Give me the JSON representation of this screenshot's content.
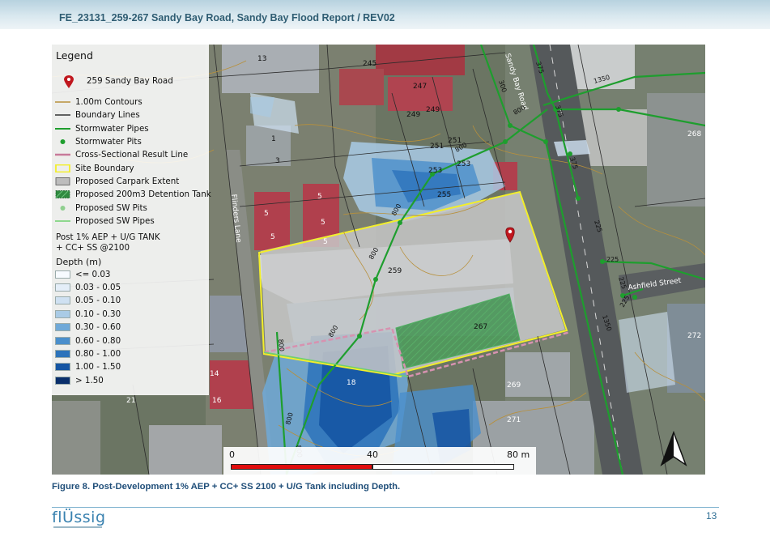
{
  "header": {
    "title": "FE_23131_259-267 Sandy Bay Road, Sandy Bay Flood Report / REV02"
  },
  "legend": {
    "title": "Legend",
    "items": [
      {
        "label": "259 Sandy Bay Road",
        "symbol": "marker",
        "color": "#c0171e"
      },
      {
        "label": "1.00m Contours",
        "symbol": "line",
        "color": "#b8903b"
      },
      {
        "label": "Boundary Lines",
        "symbol": "line",
        "color": "#333333"
      },
      {
        "label": "Stormwater Pipes",
        "symbol": "line",
        "color": "#1e9e2e"
      },
      {
        "label": "Stormwater Pits",
        "symbol": "dot",
        "color": "#1e9e2e"
      },
      {
        "label": "Cross-Sectional Result Line",
        "symbol": "line",
        "color": "#c77a9a"
      },
      {
        "label": "Site Boundary",
        "symbol": "box",
        "color": "#f2ee2a"
      },
      {
        "label": "Proposed Carpark Extent",
        "symbol": "box",
        "color": "#bdbdbd"
      },
      {
        "label": "Proposed 200m3 Detention Tank",
        "symbol": "hatch",
        "color": "#2f8a3f"
      },
      {
        "label": "Proposed SW Pits",
        "symbol": "dot",
        "color": "#8fcf8f"
      },
      {
        "label": "Proposed SW Pipes",
        "symbol": "line",
        "color": "#6fd06f"
      }
    ],
    "scenario_heading_line1": "Post 1% AEP + U/G TANK",
    "scenario_heading_line2": "+ CC+ SS @2100",
    "depth_heading": "Depth (m)",
    "depth_classes": [
      {
        "label": "<= 0.03",
        "color": "#f7fbff"
      },
      {
        "label": "0.03 - 0.05",
        "color": "#e4eef8"
      },
      {
        "label": "0.05 - 0.10",
        "color": "#cfe1f2"
      },
      {
        "label": "0.10 - 0.30",
        "color": "#a9cbe6"
      },
      {
        "label": "0.30 - 0.60",
        "color": "#6fa9d8"
      },
      {
        "label": "0.60 - 0.80",
        "color": "#4a8fcc"
      },
      {
        "label": "0.80 - 1.00",
        "color": "#2c73bb"
      },
      {
        "label": "1.00 - 1.50",
        "color": "#1555a3"
      },
      {
        "label": "> 1.50",
        "color": "#0a2f6b"
      }
    ]
  },
  "map": {
    "lot_labels": [
      "13",
      "245",
      "247",
      "249",
      "249",
      "251",
      "251",
      "253",
      "253",
      "255",
      "259",
      "267",
      "269",
      "271",
      "272",
      "268",
      "1",
      "3",
      "5",
      "5",
      "5",
      "5",
      "5",
      "18",
      "14",
      "16",
      "21"
    ],
    "road_labels": [
      "Sandy Bay Road",
      "Ashfield Street",
      "Flinders Lane"
    ],
    "pipe_labels": [
      "375",
      "300",
      "1350",
      "375",
      "375",
      "225",
      "225",
      "225",
      "225",
      "1350",
      "800",
      "800",
      "800",
      "800",
      "800",
      "800",
      "800",
      "800"
    ]
  },
  "scalebar": {
    "label_start": "0",
    "label_mid": "40",
    "label_end": "80 m",
    "color_primary": "#e00d0d"
  },
  "caption": "Figure 8. Post-Development 1% AEP + CC+ SS 2100 + U/G Tank including Depth.",
  "footer": {
    "logo_text": "flÜssig",
    "page_number": "13"
  }
}
